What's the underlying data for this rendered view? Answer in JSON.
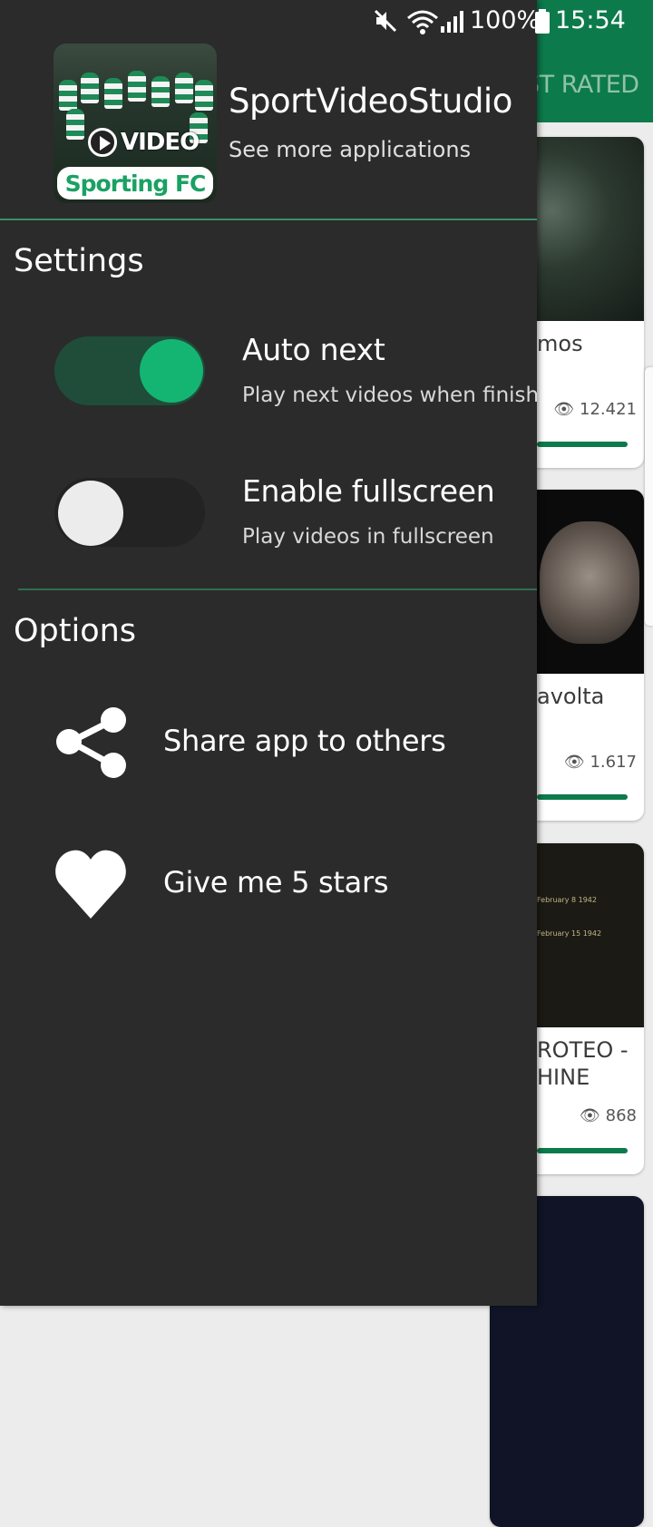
{
  "status_bar": {
    "battery": "100%",
    "time": "15:54"
  },
  "background": {
    "tab_label": "ST RATED",
    "cards": [
      {
        "title": "mos",
        "views": "12.421"
      },
      {
        "title": "avolta",
        "views": "1.617"
      },
      {
        "title": "ROTEO -\nHINE",
        "views": "868",
        "schedule": [
          "February 8 1942",
          "February 15 1942"
        ]
      }
    ]
  },
  "drawer": {
    "logo": {
      "video_text": "VIDEO",
      "banner_text": "Sporting FC"
    },
    "app_name": "SportVideoStudio",
    "app_sub": "See more applications",
    "settings": {
      "title": "Settings",
      "items": [
        {
          "title": "Auto next",
          "desc": "Play next videos when finish",
          "enabled": true
        },
        {
          "title": "Enable fullscreen",
          "desc": "Play videos in fullscreen",
          "enabled": false
        }
      ]
    },
    "options": {
      "title": "Options",
      "items": [
        {
          "label": "Share app to others",
          "icon": "share-icon"
        },
        {
          "label": "Give me 5 stars",
          "icon": "heart-icon"
        }
      ]
    }
  },
  "colors": {
    "drawer_bg": "#2b2b2b",
    "accent": "#14b573",
    "app_bar": "#0d7a4c"
  }
}
